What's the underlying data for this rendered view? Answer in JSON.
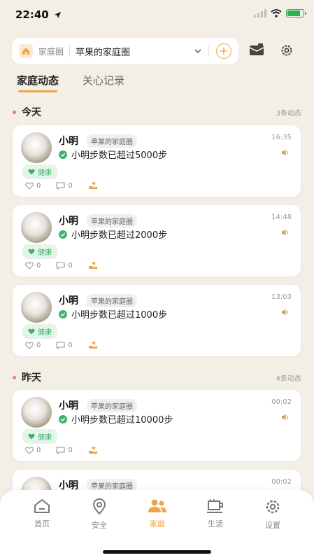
{
  "status": {
    "time": "22:40"
  },
  "header": {
    "circle_label": "家庭圈",
    "circle_name": "苹果的家庭圈",
    "add_symbol": "+"
  },
  "tabs": [
    {
      "label": "家庭动态",
      "active": true
    },
    {
      "label": "关心记录",
      "active": false
    }
  ],
  "sections": [
    {
      "title": "今天",
      "count": "3条动态"
    },
    {
      "title": "昨天",
      "count": "4条动态"
    }
  ],
  "cards": [
    {
      "name": "小明",
      "circle": "苹果的家庭圈",
      "message": "小明步数已超过5000步",
      "time": "16:35",
      "tag": "健康",
      "likes": "0",
      "comments": "0"
    },
    {
      "name": "小明",
      "circle": "苹果的家庭圈",
      "message": "小明步数已超过2000步",
      "time": "14:48",
      "tag": "健康",
      "likes": "0",
      "comments": "0"
    },
    {
      "name": "小明",
      "circle": "苹果的家庭圈",
      "message": "小明步数已超过1000步",
      "time": "13:03",
      "tag": "健康",
      "likes": "0",
      "comments": "0"
    },
    {
      "name": "小明",
      "circle": "苹果的家庭圈",
      "message": "小明步数已超过10000步",
      "time": "00:02",
      "tag": "健康",
      "likes": "0",
      "comments": "0"
    },
    {
      "name": "小明",
      "circle": "苹果的家庭圈",
      "time": "00:02"
    }
  ],
  "tabbar": [
    {
      "label": "首页",
      "icon": "home-icon",
      "active": false
    },
    {
      "label": "安全",
      "icon": "location-pin-icon",
      "active": false
    },
    {
      "label": "家庭",
      "icon": "family-icon",
      "active": true
    },
    {
      "label": "生活",
      "icon": "cup-icon",
      "active": false
    },
    {
      "label": "设置",
      "icon": "gear-icon",
      "active": false
    }
  ],
  "colors": {
    "accent": "#f0a445",
    "health": "#3db26a",
    "background": "#f4efe6"
  }
}
